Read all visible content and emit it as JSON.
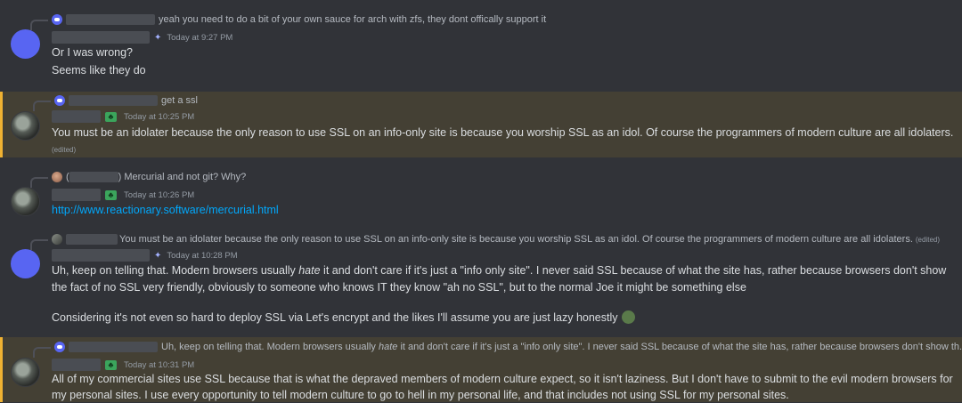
{
  "messages": [
    {
      "reply_text": "yeah you need to do a bit of your own sauce for arch with zfs, they dont offically support it",
      "timestamp": "Today at 9:27 PM",
      "lines": [
        "Or I was wrong?",
        "Seems like they do"
      ]
    },
    {
      "reply_text": "get a ssl",
      "timestamp": "Today at 10:25 PM",
      "lines": [
        "You must be an idolater because the only reason to use SSL on an info-only site is because you worship SSL as an idol.  Of course the programmers of modern culture are all idolaters."
      ],
      "edited": "(edited)"
    },
    {
      "reply_text": "Mercurial and not git? Why?",
      "timestamp": "Today at 10:26 PM",
      "link": "http://www.reactionary.software/mercurial.html"
    },
    {
      "reply_text": "You must be an idolater because the only reason to use SSL on an info-only site is because you worship SSL as an idol.  Of course the programmers of modern culture are all idolaters.",
      "reply_edited": "(edited)",
      "timestamp": "Today at 10:28 PM",
      "line1_pre": "Uh, keep on telling that. Modern browsers usually ",
      "line1_em": "hate",
      "line1_post": " it and don't care if it's just a \"info only site\". I never said SSL because of what the site has, rather because browsers don't show",
      "line2": "the fact of no SSL very friendly, obviously to someone who knows IT they know \"ah no SSL\", but to the normal Joe it might be something else",
      "line3": "Considering it's not even so hard to deploy SSL via Let's encrypt and the likes I'll assume you are just lazy honestly"
    },
    {
      "reply_pre": "Uh, keep on telling that. Modern browsers usually ",
      "reply_em": "hate",
      "reply_post": " it and don't care if it's just a \"info only site\". I never said SSL because of what the site has, rather because browsers don't show th...",
      "timestamp": "Today at 10:31 PM",
      "lines": [
        "All of my commercial sites use SSL because that is what the depraved members of modern culture expect, so it isn't laziness.  But I don't have to submit to the evil modern browsers for",
        "my personal sites.  I use every opportunity to tell modern culture to go to hell in my personal life, and that includes not using SSL for my personal sites."
      ]
    }
  ]
}
